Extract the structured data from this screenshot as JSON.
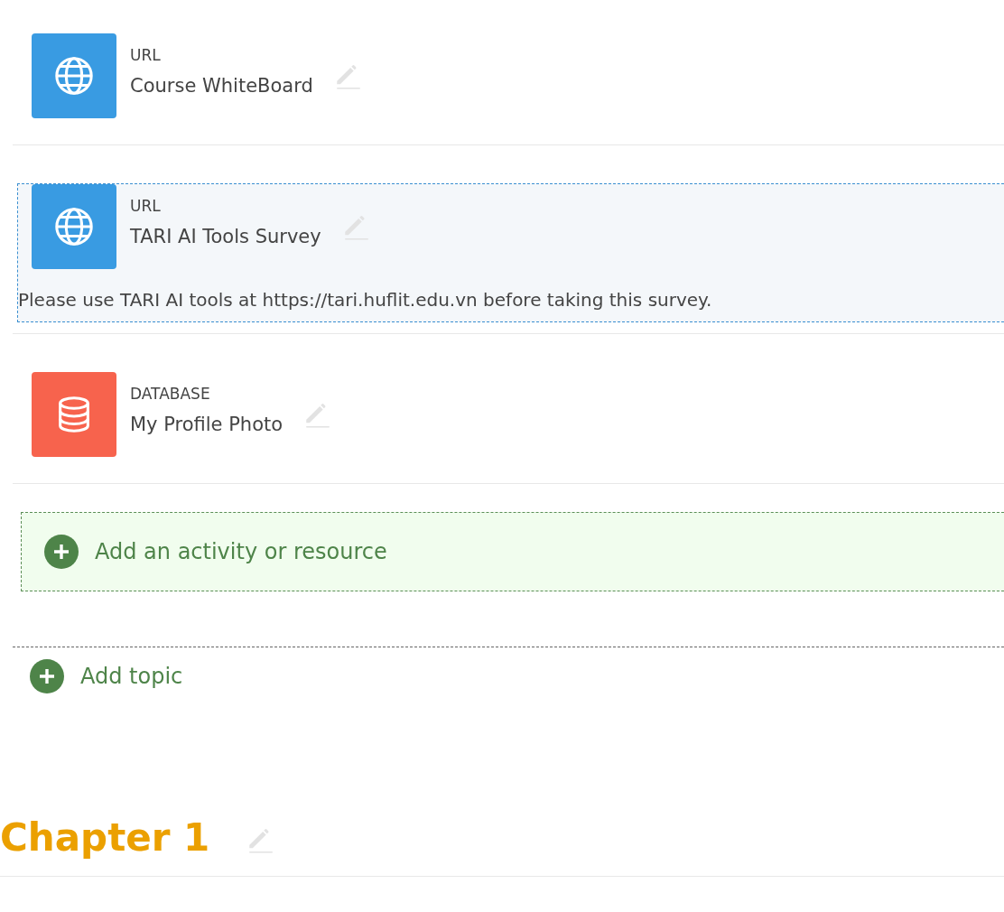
{
  "activities": [
    {
      "kind": "url",
      "type_label": "URL",
      "title": "Course WhiteBoard",
      "selected": false
    },
    {
      "kind": "url",
      "type_label": "URL",
      "title": "TARI AI Tools Survey",
      "selected": true,
      "description": "Please use TARI AI tools at https://tari.huflit.edu.vn before taking this survey."
    },
    {
      "kind": "database",
      "type_label": "DATABASE",
      "title": "My Profile Photo",
      "selected": false
    }
  ],
  "add_activity": {
    "label": "Add an activity or resource"
  },
  "add_topic": {
    "label": "Add topic"
  },
  "next_section": {
    "title": "Chapter 1"
  }
}
